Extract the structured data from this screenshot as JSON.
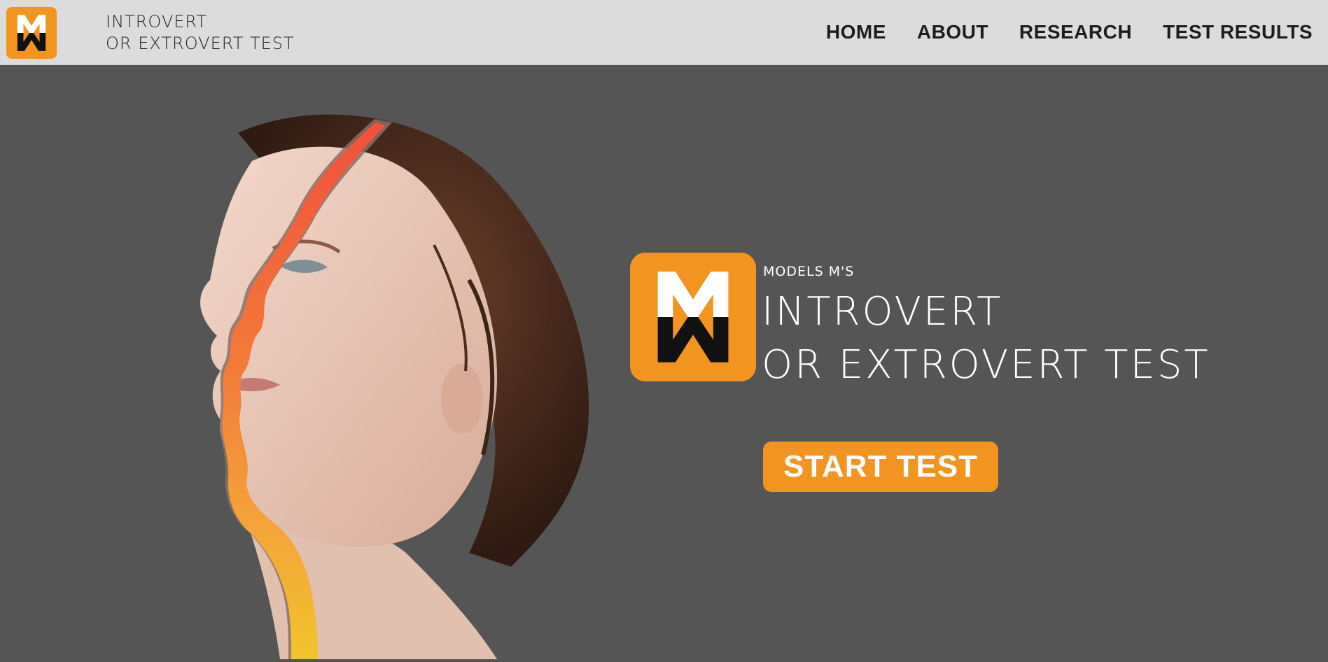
{
  "header": {
    "logo_icon": "mw-monogram-logo",
    "brand_line1": "INTROVERT",
    "brand_line2": "OR EXTROVERT TEST",
    "nav": [
      {
        "label": "HOME"
      },
      {
        "label": "ABOUT"
      },
      {
        "label": "RESEARCH"
      },
      {
        "label": "TEST RESULTS"
      }
    ]
  },
  "hero": {
    "image": "woman-profile-with-color-stripe",
    "logo_icon": "mw-monogram-logo",
    "kicker": "MODELS M'S",
    "title_line1": "INTROVERT",
    "title_line2": "OR EXTROVERT TEST",
    "cta_label": "START TEST"
  },
  "colors": {
    "accent": "#f29420",
    "header_bg": "#dcdcdc",
    "page_bg": "#555555",
    "text_light": "#ffffff",
    "text_dark": "#1d1d1d"
  }
}
